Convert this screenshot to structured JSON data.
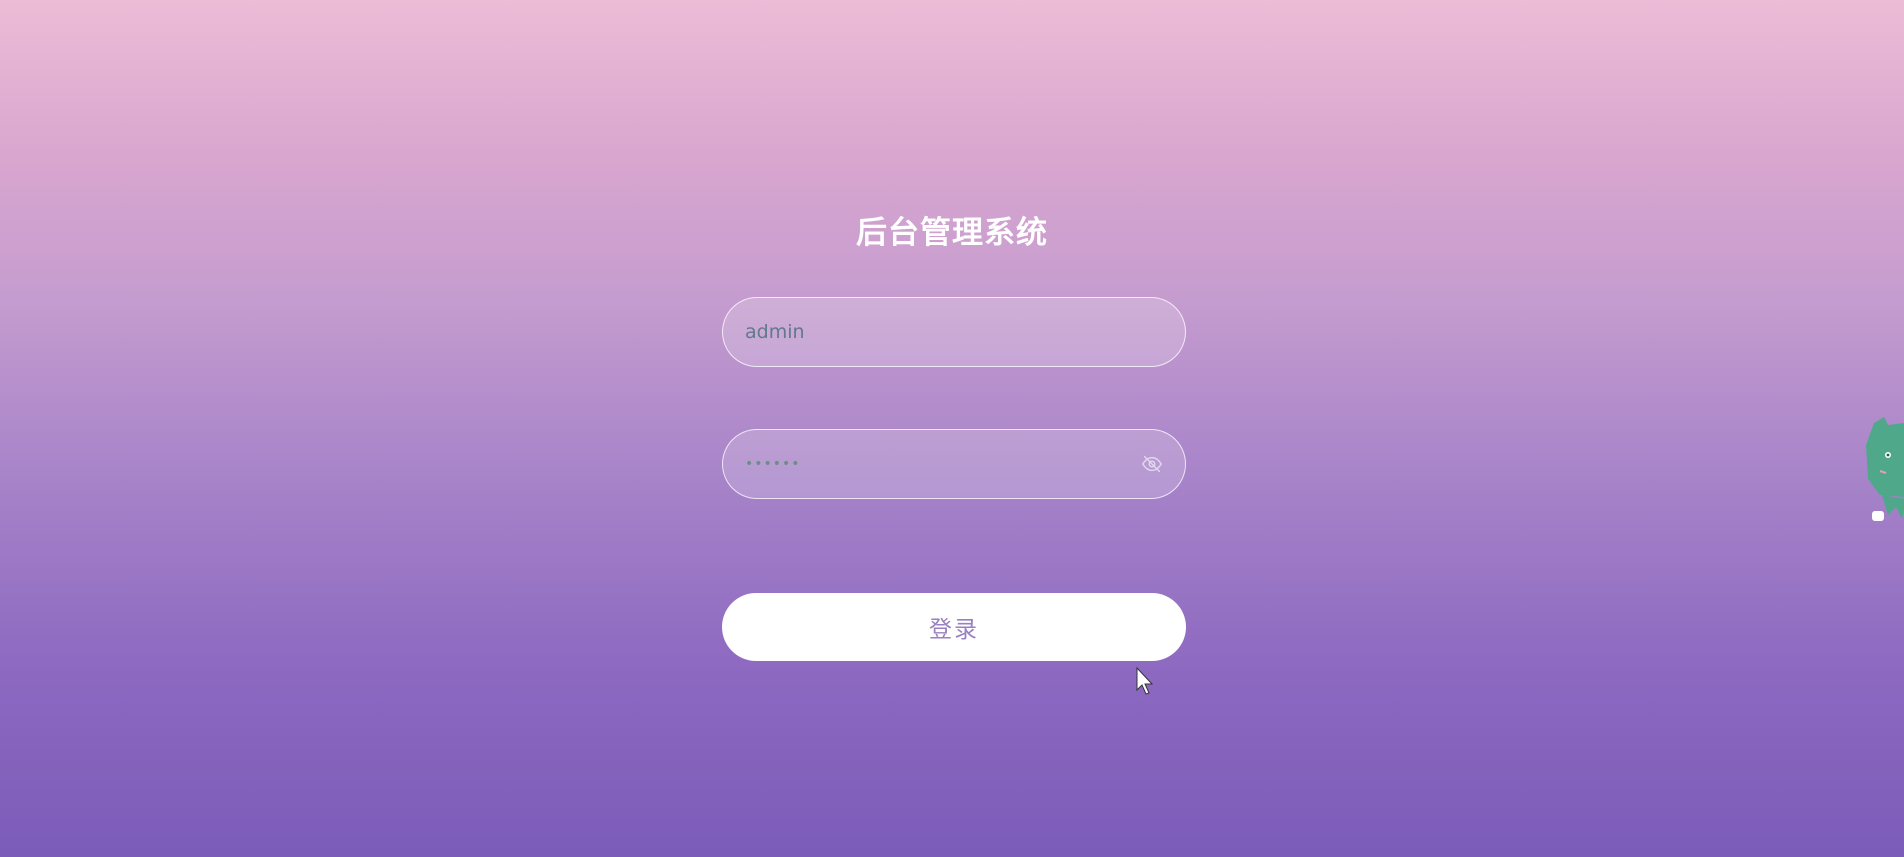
{
  "page": {
    "title": "后台管理系统"
  },
  "login_form": {
    "username": {
      "value": "admin",
      "placeholder": ""
    },
    "password": {
      "value": "••••••",
      "placeholder": "",
      "toggle_icon": "eye-slash-icon"
    },
    "submit_label": "登录"
  },
  "decorations": {
    "mascot_icon": "cat-mascot-icon",
    "mascot_color": "#4fa88a"
  },
  "colors": {
    "gradient_top": "#ecbcd6",
    "gradient_bottom": "#7b5cb8",
    "button_text": "#9a7fc2"
  }
}
